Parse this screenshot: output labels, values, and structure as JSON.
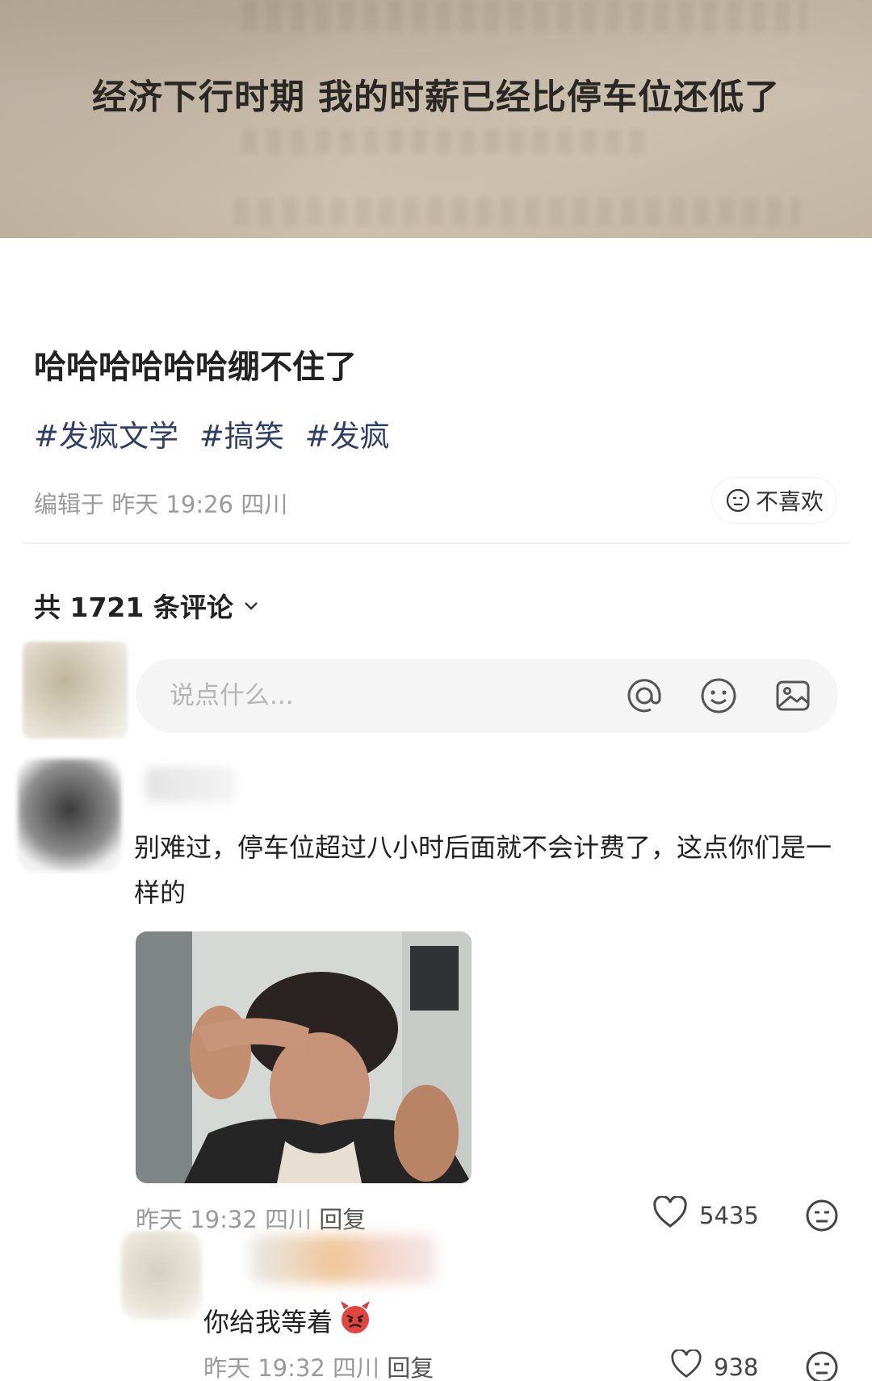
{
  "banner": {
    "text": "经济下行时期 我的时薪已经比停车位还低了"
  },
  "post": {
    "title": "哈哈哈哈哈哈绷不住了",
    "tags": [
      "#发疯文学",
      "#搞笑",
      "#发疯"
    ],
    "meta": "编辑于 昨天 19:26 四川",
    "dislike_label": "不喜欢"
  },
  "comments_header": {
    "label": "共 1721 条评论"
  },
  "comment_input": {
    "placeholder": "说点什么..."
  },
  "comments": [
    {
      "text": "别难过，停车位超过八小时后面就不会计费了，这点你们是一样的",
      "time": "昨天 19:32 四川",
      "reply_label": "回复",
      "likes": "5435"
    },
    {
      "text": "你给我等着",
      "time": "昨天 19:32 四川",
      "reply_label": "回复",
      "likes": "938"
    }
  ],
  "icons": [
    "at-icon",
    "emoji-icon",
    "image-icon",
    "heart-icon",
    "dislike-face-icon",
    "chevron-down-icon",
    "angry-devil-emoji"
  ]
}
